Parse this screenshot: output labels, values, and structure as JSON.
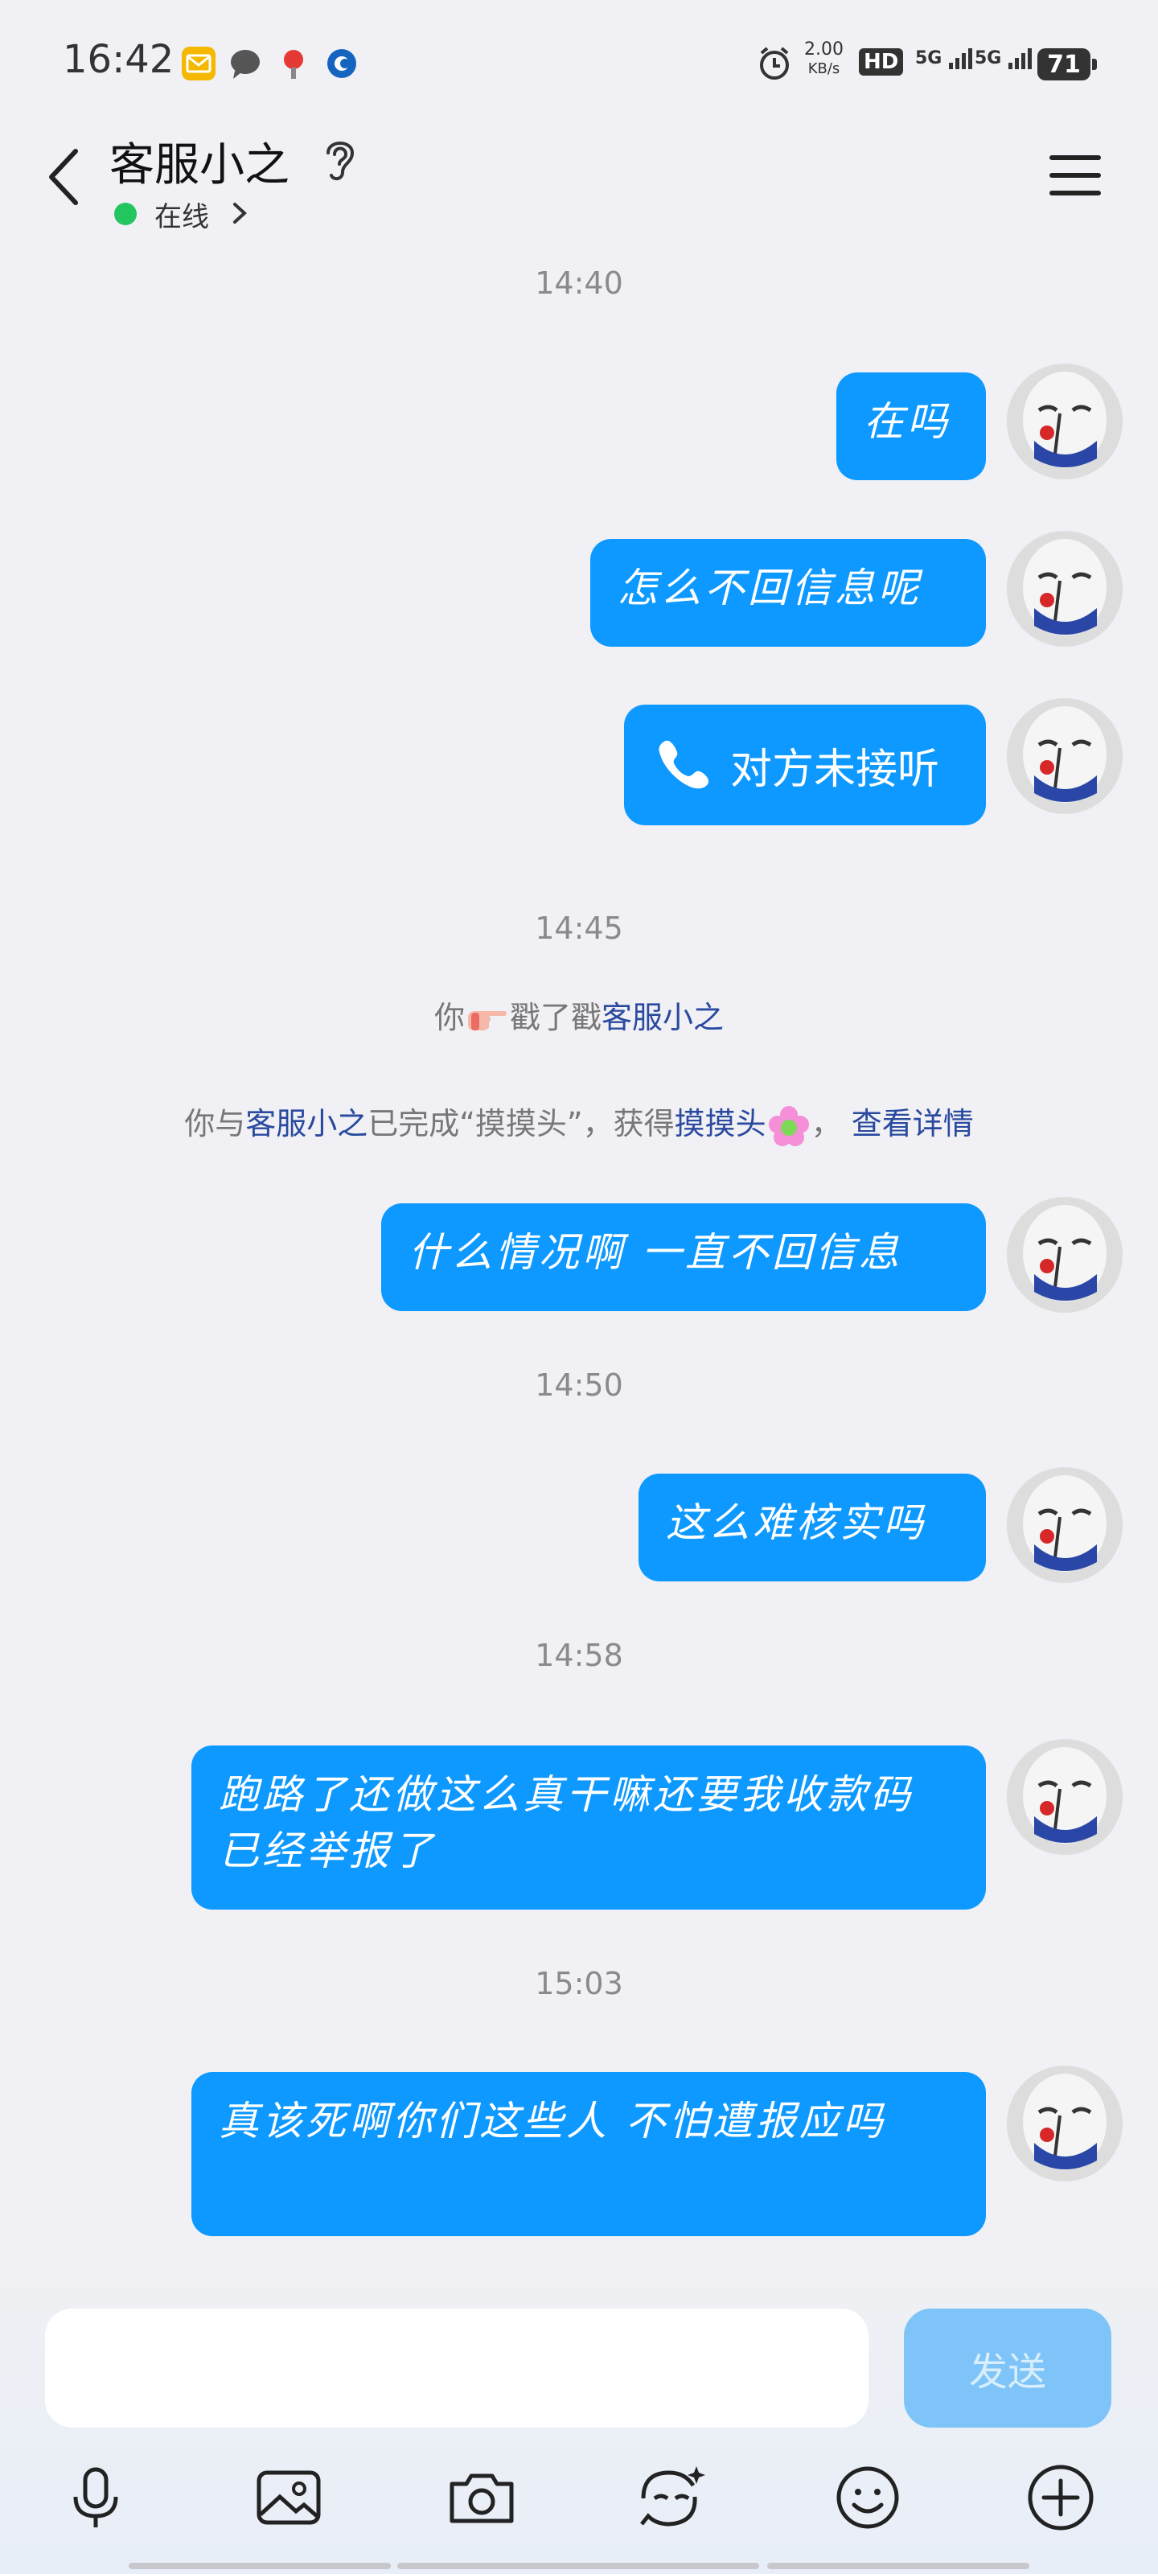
{
  "status_bar": {
    "time": "16:42",
    "net_speed_value": "2.00",
    "net_speed_unit": "KB/s",
    "hd": "HD",
    "signal1": "5G",
    "signal2": "5G",
    "battery": "71"
  },
  "header": {
    "title": "客服小之",
    "status": "在线"
  },
  "chat": {
    "times": [
      "14:40",
      "14:45",
      "14:50",
      "14:58",
      "15:03"
    ],
    "messages": [
      "在吗",
      "怎么不回信息呢",
      "对方未接听",
      "什么情况啊 一直不回信息",
      "这么难核实吗",
      "跑路了还做这么真干嘛还要我收款码 已经举报了",
      "真该死啊你们这些人 不怕遭报应吗"
    ],
    "poke": {
      "you": "你",
      "verb": "戳了戳",
      "target": "客服小之"
    },
    "achievement": {
      "prefix": "你与",
      "name": "客服小之",
      "middle": "已完成“摸摸头”，获得",
      "badge": "摸摸头",
      "sep": "，",
      "link": "查看详情"
    }
  },
  "input": {
    "placeholder": "",
    "send_label": "发送"
  },
  "toolbar": {
    "icons": [
      "microphone-icon",
      "image-icon",
      "camera-icon",
      "sticker-icon",
      "emoji-icon",
      "plus-icon"
    ]
  },
  "colors": {
    "bubble": "#0d99ff",
    "background": "#f0f0f5",
    "online": "#22c55e",
    "link": "#2a4a9f",
    "send_button": "#7ec4f8"
  }
}
